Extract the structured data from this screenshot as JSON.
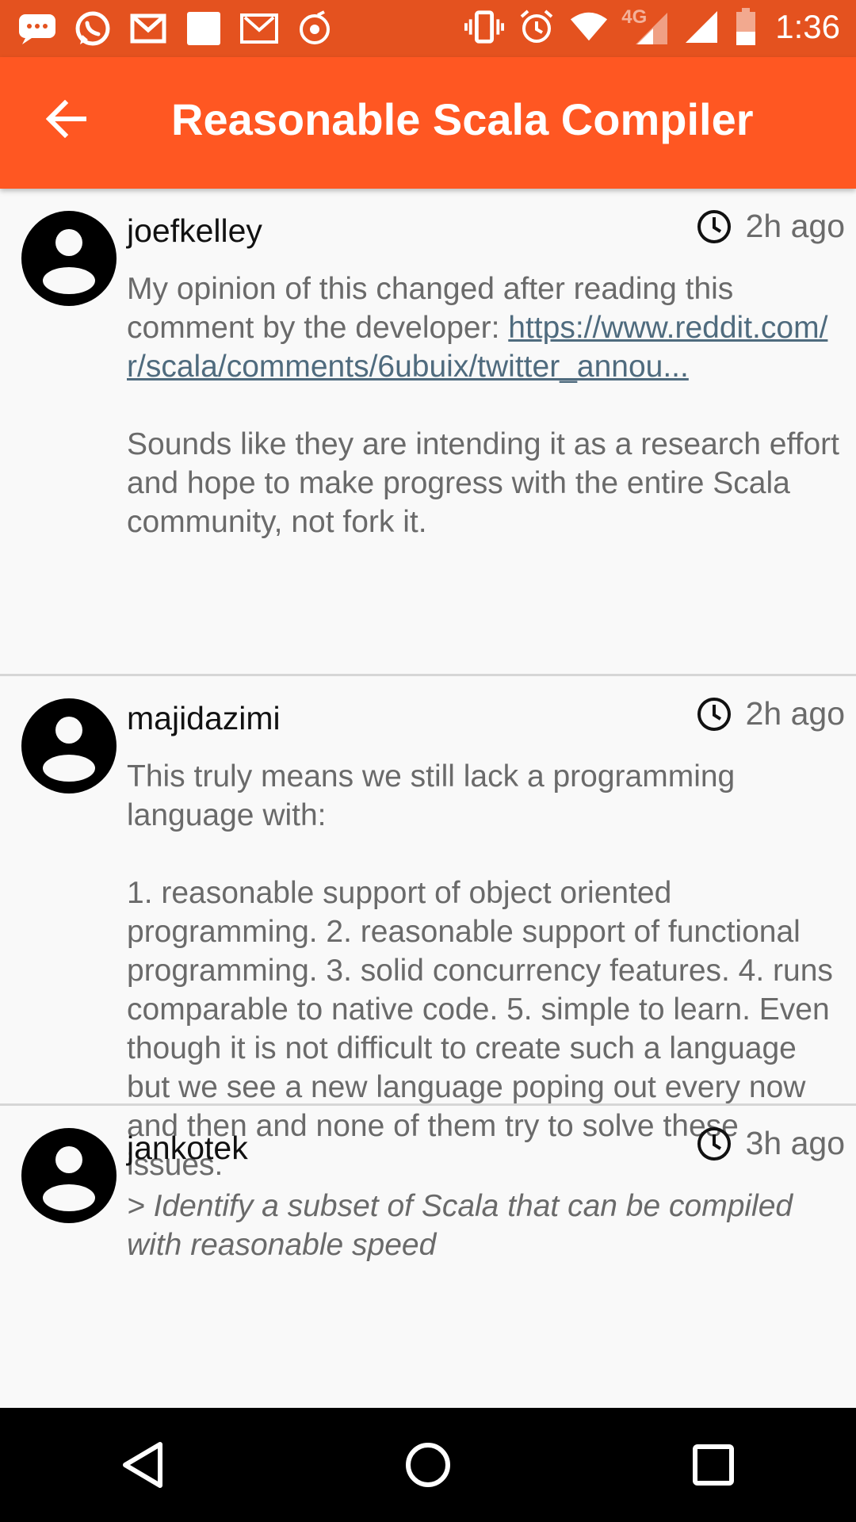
{
  "status_bar": {
    "network": "4G",
    "time": "1:36",
    "icons_left": [
      "messaging-icon",
      "whatsapp-icon",
      "gmail-icon",
      "blank-notification-icon",
      "gmail-icon",
      "music-icon"
    ],
    "icons_right": [
      "vibrate-icon",
      "alarm-icon",
      "wifi-icon",
      "signal-icon",
      "signal-icon",
      "battery-icon"
    ]
  },
  "app_bar": {
    "title": "Reasonable Scala Compiler",
    "back_icon": "arrow-back-icon"
  },
  "comments": [
    {
      "author": "joefkelley",
      "time": "2h ago",
      "paragraphs": [
        {
          "text": "My opinion of this changed after reading this comment by the developer: ",
          "link": "https://www.reddit.com/r/scala/comments/6ubuix/twitter_annou..."
        },
        {
          "text": "Sounds like they are intending it as a research effort and hope to make progress with the entire Scala community, not fork it."
        }
      ]
    },
    {
      "author": "majidazimi",
      "time": "2h ago",
      "paragraphs": [
        {
          "text": "This truly means we still lack a programming language with:"
        },
        {
          "text": "1. reasonable support of object oriented programming. 2. reasonable support of functional programming. 3. solid concurrency features. 4. runs comparable to native code. 5. simple to learn. Even though it is not difficult to create such a language but we see a new language poping out every now and then and none of them try to solve these issues."
        }
      ]
    },
    {
      "author": "jankotek",
      "time": "3h ago",
      "paragraphs": [
        {
          "text": "> Identify a subset of Scala that can be compiled with reasonable speed"
        }
      ]
    }
  ],
  "colors": {
    "status_bar": "#e4521f",
    "app_bar": "#ff5722",
    "link": "#4f6b7e",
    "body_text": "#6a6a6a"
  },
  "nav": {
    "back": "nav-back-icon",
    "home": "nav-home-icon",
    "recents": "nav-recents-icon"
  }
}
